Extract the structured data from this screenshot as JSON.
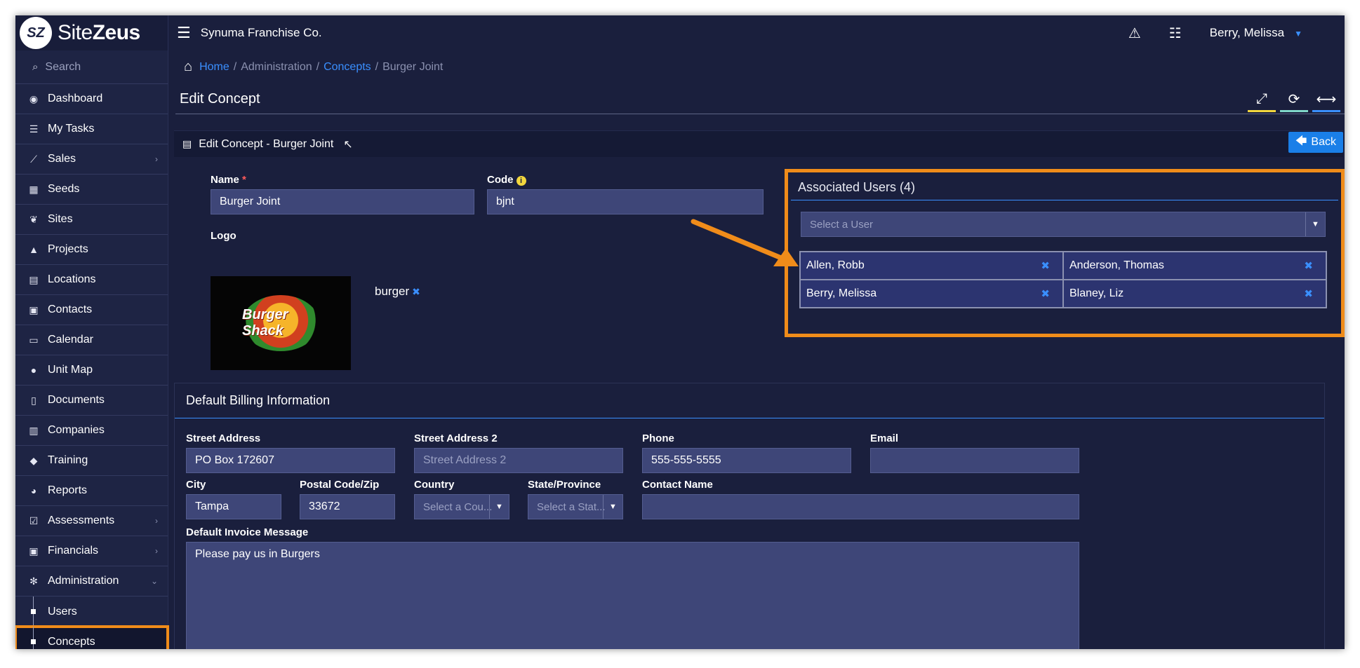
{
  "app": {
    "logo_mark": "SZ",
    "brand_light": "Site",
    "brand_bold": "Zeus",
    "org": "Synuma Franchise Co.",
    "user": "Berry, Melissa"
  },
  "sidebar": {
    "search": "Search",
    "items": [
      {
        "label": "Dashboard",
        "icon": "dashboard-icon",
        "glyph": "◉"
      },
      {
        "label": "My Tasks",
        "icon": "tasks-icon",
        "glyph": "☰"
      },
      {
        "label": "Sales",
        "icon": "chart-line-icon",
        "glyph": "⟋",
        "chevron": "›"
      },
      {
        "label": "Seeds",
        "icon": "grid-icon",
        "glyph": "▦"
      },
      {
        "label": "Sites",
        "icon": "leaf-icon",
        "glyph": "❦"
      },
      {
        "label": "Projects",
        "icon": "road-icon",
        "glyph": "▲"
      },
      {
        "label": "Locations",
        "icon": "building-icon",
        "glyph": "▤"
      },
      {
        "label": "Contacts",
        "icon": "contact-card-icon",
        "glyph": "▣"
      },
      {
        "label": "Calendar",
        "icon": "calendar-icon",
        "glyph": "▭"
      },
      {
        "label": "Unit Map",
        "icon": "globe-icon",
        "glyph": "●"
      },
      {
        "label": "Documents",
        "icon": "file-icon",
        "glyph": "▯"
      },
      {
        "label": "Companies",
        "icon": "company-icon",
        "glyph": "▥"
      },
      {
        "label": "Training",
        "icon": "graduation-cap-icon",
        "glyph": "◆"
      },
      {
        "label": "Reports",
        "icon": "pie-chart-icon",
        "glyph": "◕"
      },
      {
        "label": "Assessments",
        "icon": "checkbox-icon",
        "glyph": "☑",
        "chevron": "›"
      },
      {
        "label": "Financials",
        "icon": "money-icon",
        "glyph": "▣",
        "chevron": "›"
      },
      {
        "label": "Administration",
        "icon": "gears-icon",
        "glyph": "✻",
        "chevron": "⌄"
      }
    ],
    "sub_items": [
      "Users",
      "Concepts"
    ]
  },
  "breadcrumb": {
    "home": "Home",
    "sep": "/",
    "admin": "Administration",
    "concepts": "Concepts",
    "current": "Burger Joint"
  },
  "page_title": "Edit Concept",
  "card": {
    "title": "Edit Concept - Burger Joint",
    "back": "Back",
    "back_glyph": "🡄"
  },
  "form": {
    "name_label": "Name",
    "req": "*",
    "name_value": "Burger Joint",
    "code_label": "Code",
    "code_info": "i",
    "code_value": "bjnt",
    "logo_label": "Logo",
    "logo_file": "burger",
    "logo_text": "Burger Shack"
  },
  "associated": {
    "title": "Associated Users (4)",
    "select_placeholder": "Select a User",
    "users": [
      "Allen, Robb",
      "Anderson, Thomas",
      "Berry, Melissa",
      "Blaney, Liz"
    ]
  },
  "billing": {
    "title": "Default Billing Information",
    "street_label": "Street Address",
    "street_value": "PO Box 172607",
    "street2_label": "Street Address 2",
    "street2_placeholder": "Street Address 2",
    "phone_label": "Phone",
    "phone_value": "555-555-5555",
    "email_label": "Email",
    "email_value": "",
    "city_label": "City",
    "city_value": "Tampa",
    "zip_label": "Postal Code/Zip",
    "zip_value": "33672",
    "country_label": "Country",
    "country_placeholder": "Select a Cou...",
    "state_label": "State/Province",
    "state_placeholder": "Select a Stat...",
    "contact_label": "Contact Name",
    "contact_value": "",
    "invoice_label": "Default Invoice Message",
    "invoice_value": "Please pay us in Burgers"
  },
  "colors": {
    "accent": "#3a8fff",
    "highlight": "#f08c1a",
    "bg": "#1a1f3d",
    "input": "#3e4678"
  }
}
